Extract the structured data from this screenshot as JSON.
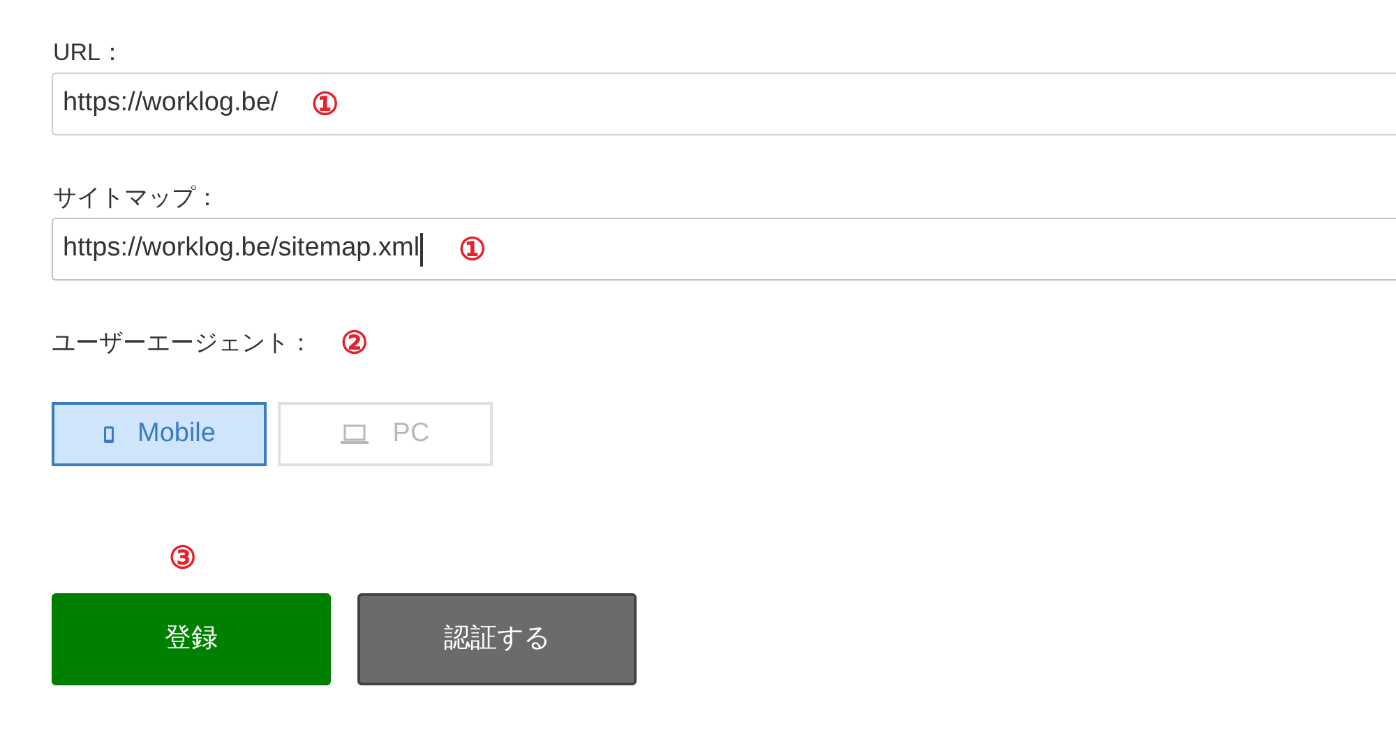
{
  "fields": [
    {
      "label": "URL：",
      "value": "https://worklog.be/",
      "marker": "①",
      "focused": false
    },
    {
      "label": "サイトマップ：",
      "value": "https://worklog.be/sitemap.xml",
      "marker": "①",
      "focused": true
    }
  ],
  "user_agent": {
    "label": "ユーザーエージェント：",
    "marker": "②",
    "options": [
      {
        "label": "Mobile",
        "kind": "mobile",
        "selected": true
      },
      {
        "label": "PC",
        "kind": "pc",
        "selected": false
      }
    ]
  },
  "actions": {
    "marker": "③",
    "buttons": [
      {
        "label": "登録",
        "kind": "primary"
      },
      {
        "label": "認証する",
        "kind": "secondary"
      }
    ]
  }
}
